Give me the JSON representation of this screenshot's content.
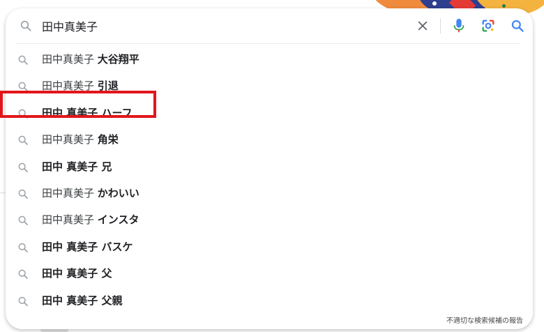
{
  "search": {
    "query": "田中真美子",
    "icons": {
      "search": "search-icon",
      "clear": "close-icon",
      "voice": "microphone-icon",
      "lens": "lens-camera-icon",
      "submit": "search-icon"
    }
  },
  "suggestions": [
    {
      "prefix": "田中真美子 ",
      "bold": "大谷翔平",
      "full_bold": ""
    },
    {
      "prefix": "田中真美子 ",
      "bold": "引退",
      "full_bold": ""
    },
    {
      "prefix": "",
      "bold": "",
      "full_bold": "田中 真美子 ハーフ"
    },
    {
      "prefix": "田中真美子 ",
      "bold": "角栄",
      "full_bold": ""
    },
    {
      "prefix": "",
      "bold": "",
      "full_bold": "田中 真美子 兄"
    },
    {
      "prefix": "田中真美子 ",
      "bold": "かわいい",
      "full_bold": ""
    },
    {
      "prefix": "田中真美子 ",
      "bold": "インスタ",
      "full_bold": ""
    },
    {
      "prefix": "",
      "bold": "",
      "full_bold": "田中 真美子 バスケ"
    },
    {
      "prefix": "",
      "bold": "",
      "full_bold": "田中 真美子 父"
    },
    {
      "prefix": "",
      "bold": "",
      "full_bold": "田中 真美子 父親"
    }
  ],
  "highlighted_index": 2,
  "footer": {
    "report_label": "不適切な検索候補の報告"
  },
  "colors": {
    "highlight": "#e2161a",
    "mic_blue": "#4285f4",
    "mic_red": "#ea4335"
  }
}
